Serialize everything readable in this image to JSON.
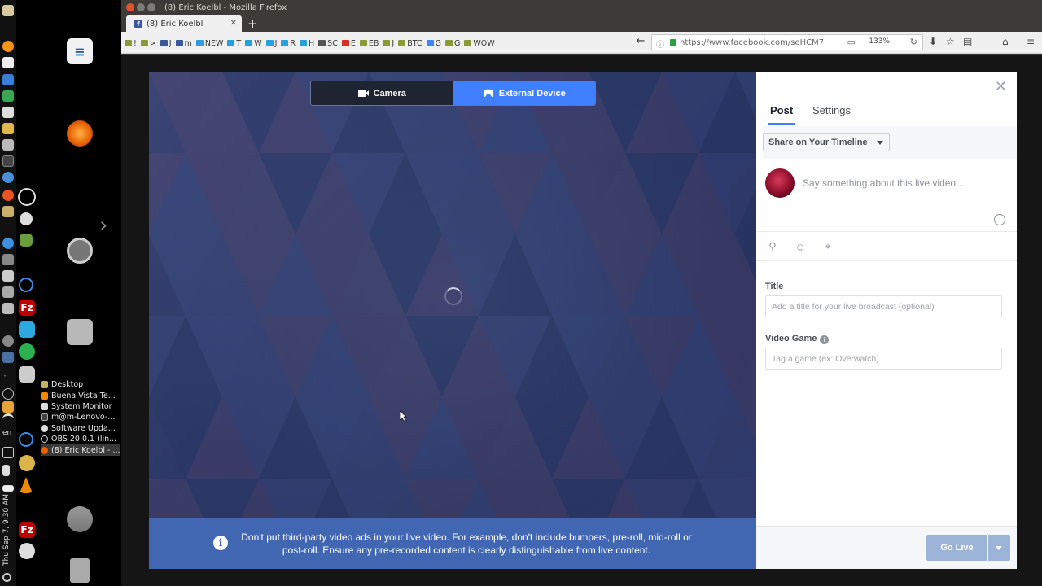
{
  "system": {
    "clock": "Thu Sep 7,  9:30 AM",
    "language": "en"
  },
  "taskbar": {
    "items": [
      {
        "label": "Desktop",
        "icon": "folder-icon"
      },
      {
        "label": "Buena Vista Te...",
        "icon": "vlc-icon"
      },
      {
        "label": "System Monitor",
        "icon": "monitor-icon"
      },
      {
        "label": "m@m-Lenovo-...",
        "icon": "terminal-icon"
      },
      {
        "label": "Software Upda...",
        "icon": "update-icon"
      },
      {
        "label": "OBS 20.0.1 (lin...",
        "icon": "obs-icon"
      },
      {
        "label": "(8) Eric Koelbl - ...",
        "icon": "firefox-icon"
      }
    ]
  },
  "window": {
    "title": "(8) Eric Koelbl - Mozilla Firefox",
    "tab_title": "(8) Eric Koelbl",
    "url": "https://www.facebook.com/seHCM7",
    "zoom": "133%"
  },
  "bookmarks": [
    "!",
    ">",
    "J",
    "m",
    "NEW",
    "T",
    "W",
    "J",
    "R",
    "H",
    "SC",
    "E",
    "EB",
    "J",
    "BTC",
    "G",
    "G",
    "WOW"
  ],
  "live": {
    "mode_camera": "Camera",
    "mode_external": "External Device",
    "notice": "Don't put third-party video ads in your live video. For example, don't include bumpers, pre-roll, mid-roll or post-roll. Ensure any pre-recorded content is clearly distinguishable from live content."
  },
  "panel": {
    "tab_post": "Post",
    "tab_settings": "Settings",
    "share_target": "Share on Your Timeline",
    "compose_placeholder": "Say something about this live video...",
    "title_label": "Title",
    "title_placeholder": "Add a title for your live broadcast (optional)",
    "game_label": "Video Game",
    "game_placeholder": "Tag a game (ex: Overwatch)",
    "go_live": "Go Live"
  },
  "colors": {
    "accent": "#4080ff",
    "notice_bg": "#4267b2",
    "golive_disabled": "#9cb4d8"
  }
}
